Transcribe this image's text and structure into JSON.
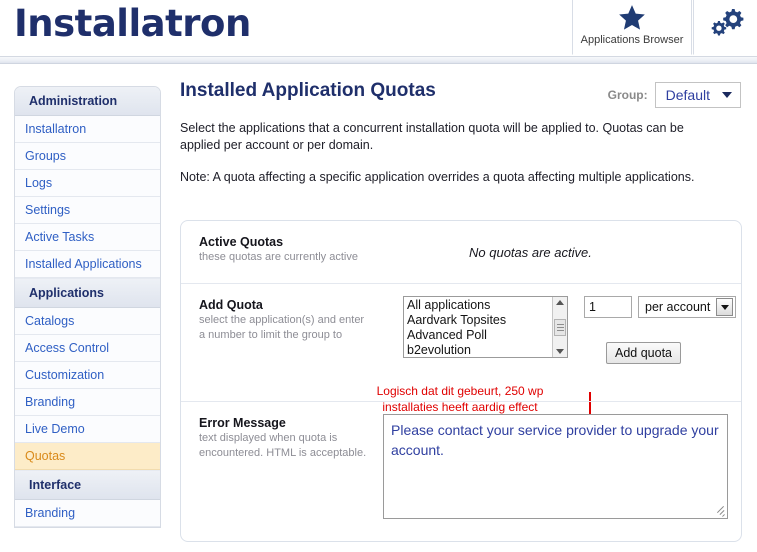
{
  "header": {
    "logo_text": "Installatron",
    "tabs": [
      {
        "label": "Applications Browser",
        "icon": "star-icon"
      },
      {
        "label": "",
        "icon": "gears-icon"
      }
    ]
  },
  "sidebar": {
    "groups": [
      {
        "title": "Administration",
        "items": [
          {
            "label": "Installatron",
            "selected": false
          },
          {
            "label": "Groups",
            "selected": false
          },
          {
            "label": "Logs",
            "selected": false
          },
          {
            "label": "Settings",
            "selected": false
          },
          {
            "label": "Active Tasks",
            "selected": false
          },
          {
            "label": "Installed Applications",
            "selected": false
          }
        ]
      },
      {
        "title": "Applications",
        "items": [
          {
            "label": "Catalogs",
            "selected": false
          },
          {
            "label": "Access Control",
            "selected": false
          },
          {
            "label": "Customization",
            "selected": false
          },
          {
            "label": "Branding",
            "selected": false
          },
          {
            "label": "Live Demo",
            "selected": false
          },
          {
            "label": "Quotas",
            "selected": true
          }
        ]
      },
      {
        "title": "Interface",
        "items": [
          {
            "label": "Branding",
            "selected": false
          }
        ]
      }
    ]
  },
  "main": {
    "page_title": "Installed Application Quotas",
    "group_label": "Group:",
    "group_value": "Default",
    "description_1": "Select the applications that a concurrent installation quota will be applied to. Quotas can be applied per account or per domain.",
    "description_2": "Note: A quota affecting a specific application overrides a quota affecting multiple applications.",
    "active_quotas": {
      "title": "Active Quotas",
      "subtitle": "these quotas are currently active",
      "status": "No quotas are active."
    },
    "add_quota": {
      "title": "Add Quota",
      "subtitle_line1": "select the application(s) and enter",
      "subtitle_line2": "a number to limit the group to",
      "app_options": [
        "All applications",
        "Aardvark Topsites",
        "Advanced Poll",
        "b2evolution"
      ],
      "quantity_value": "1",
      "scope_value": "per account",
      "button_label": "Add quota"
    },
    "annotation": {
      "line1": "Logisch dat dit gebeurt, 250 wp",
      "line2": "installaties heeft aardig effect",
      "color": "#e00000"
    },
    "error_message": {
      "title": "Error Message",
      "subtitle_line1": "text displayed when quota is",
      "subtitle_line2": "encountered. HTML is acceptable.",
      "value": "Please contact your service provider to upgrade your account."
    }
  },
  "colors": {
    "brand": "#1f2f6b",
    "link": "#2f5fc4",
    "selected_bg": "#fdecc8",
    "selected_text": "#d98a1a",
    "annotation": "#e00000"
  }
}
